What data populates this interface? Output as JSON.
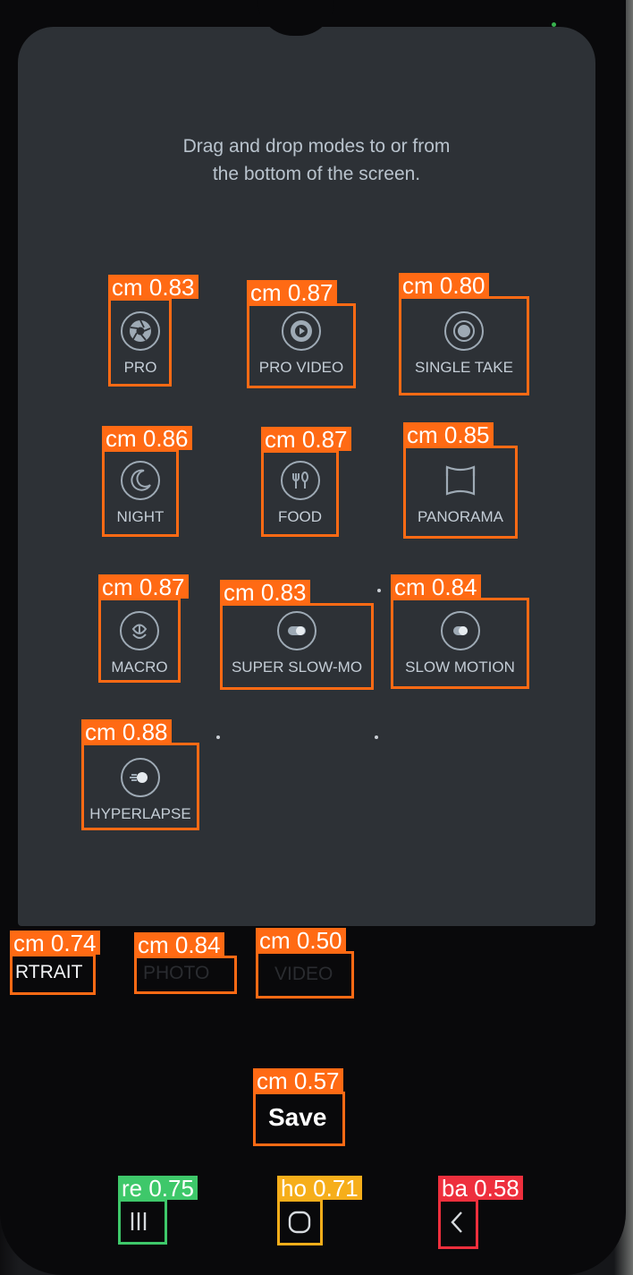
{
  "instruction": {
    "line1": "Drag and drop modes to or from",
    "line2": "the bottom of the screen."
  },
  "modes": {
    "pro": "PRO",
    "pro_video": "PRO VIDEO",
    "single_take": "SINGLE TAKE",
    "night": "NIGHT",
    "food": "FOOD",
    "panorama": "PANORAMA",
    "macro": "MACRO",
    "super_slow_mo": "SUPER SLOW-MO",
    "slow_motion": "SLOW MOTION",
    "hyperlapse": "HYPERLAPSE"
  },
  "bottom_modes": {
    "portrait": "RTRAIT",
    "photo": "PHOTO",
    "video": "VIDEO"
  },
  "save_label": "Save",
  "detections": {
    "pro": "cm 0.83",
    "pro_video": "cm 0.87",
    "single_take": "cm 0.80",
    "night": "cm 0.86",
    "food": "cm 0.87",
    "panorama": "cm 0.85",
    "macro": "cm 0.87",
    "super_slow_mo": "cm 0.83",
    "slow_motion": "cm 0.84",
    "hyperlapse": "cm 0.88",
    "portrait": "cm 0.74",
    "photo": "cm 0.84",
    "video": "cm 0.50",
    "save": "cm 0.57",
    "recents": "re 0.75",
    "home": "ho 0.71",
    "back": "ba 0.58"
  },
  "colors": {
    "detection_orange": "#ff6a14",
    "detection_green": "#3ec86a",
    "detection_yellow": "#f6ae1a",
    "detection_red": "#ee2f3d",
    "screen_bg": "#2d3136"
  }
}
